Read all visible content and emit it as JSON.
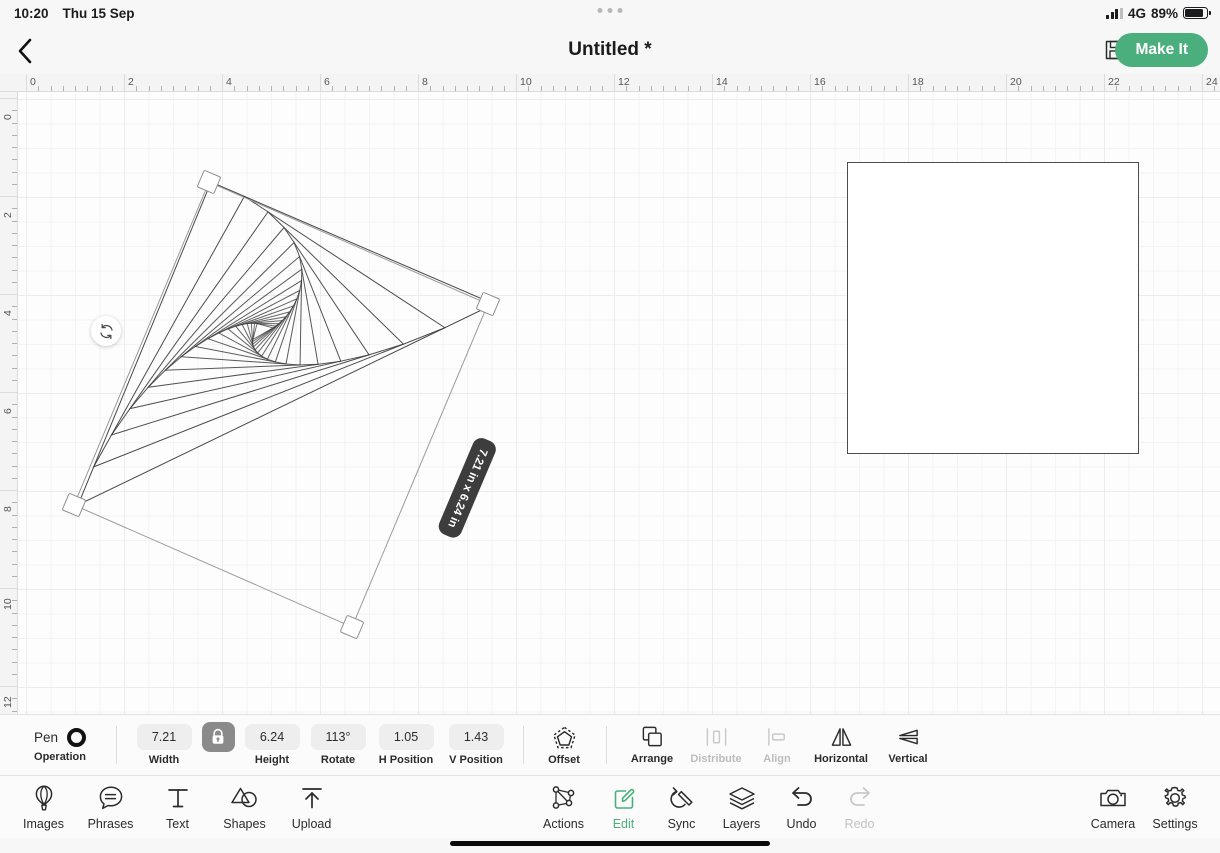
{
  "status_bar": {
    "time": "10:20",
    "date": "Thu 15 Sep",
    "network": "4G",
    "battery_percent": "89%",
    "battery_level": 89,
    "signal_icon": "cellular-signal-icon",
    "battery_icon": "battery-icon"
  },
  "header": {
    "back_icon": "chevron-left-icon",
    "title": "Untitled *",
    "save_icon": "floppy-disk-icon",
    "make_it_label": "Make It",
    "accent_color": "#4aaf7c",
    "multitask_icon": "multitasking-dots-icon"
  },
  "canvas": {
    "ruler_h_labels": [
      "0",
      "2",
      "4",
      "6",
      "8",
      "10",
      "12",
      "14",
      "16",
      "18",
      "20",
      "22",
      "24"
    ],
    "ruler_v_labels": [
      "0",
      "2",
      "4",
      "6",
      "8",
      "10",
      "12"
    ],
    "size_badge": "7.21 in x 6.24 in",
    "rotate_handle_icon": "rotate-icon",
    "selection_handle_icon": "resize-handle-icon",
    "mat_square_name": "empty-square-shape",
    "artwork_name": "spirograph-triangles-design"
  },
  "properties": {
    "operation": {
      "label": "Operation",
      "value": "Pen",
      "swatch_color": "#111111",
      "icon": "pen-color-circle-icon"
    },
    "width": {
      "label": "Width",
      "value": "7.21"
    },
    "lock": {
      "label": "lock-aspect-ratio",
      "icon": "lock-closed-icon",
      "active": true
    },
    "height": {
      "label": "Height",
      "value": "6.24"
    },
    "rotate": {
      "label": "Rotate",
      "value": "113°"
    },
    "h_position": {
      "label": "H Position",
      "value": "1.05"
    },
    "v_position": {
      "label": "V Position",
      "value": "1.43"
    },
    "offset": {
      "label": "Offset",
      "icon": "offset-pentagon-icon"
    },
    "arrange": {
      "label": "Arrange",
      "icon": "arrange-layers-icon",
      "enabled": true
    },
    "distribute": {
      "label": "Distribute",
      "icon": "distribute-icon",
      "enabled": false
    },
    "align": {
      "label": "Align",
      "icon": "align-icon",
      "enabled": false
    },
    "flip_horizontal": {
      "label": "Horizontal",
      "icon": "flip-horizontal-icon",
      "enabled": true
    },
    "flip_vertical": {
      "label": "Vertical",
      "icon": "flip-vertical-icon",
      "enabled": true
    }
  },
  "nav_left": [
    {
      "label": "Images",
      "icon": "hot-air-balloon-icon"
    },
    {
      "label": "Phrases",
      "icon": "speech-bubble-icon"
    },
    {
      "label": "Text",
      "icon": "text-t-icon"
    },
    {
      "label": "Shapes",
      "icon": "shapes-icon"
    },
    {
      "label": "Upload",
      "icon": "upload-arrow-icon"
    }
  ],
  "nav_center": [
    {
      "label": "Actions",
      "icon": "actions-nodes-icon",
      "state": "normal"
    },
    {
      "label": "Edit",
      "icon": "edit-pencil-icon",
      "state": "active"
    },
    {
      "label": "Sync",
      "icon": "sync-pen-icon",
      "state": "normal"
    },
    {
      "label": "Layers",
      "icon": "layers-stack-icon",
      "state": "normal"
    },
    {
      "label": "Undo",
      "icon": "undo-arrow-icon",
      "state": "normal"
    },
    {
      "label": "Redo",
      "icon": "redo-arrow-icon",
      "state": "disabled"
    }
  ],
  "nav_right": [
    {
      "label": "Camera",
      "icon": "camera-icon"
    },
    {
      "label": "Settings",
      "icon": "gear-icon"
    }
  ]
}
